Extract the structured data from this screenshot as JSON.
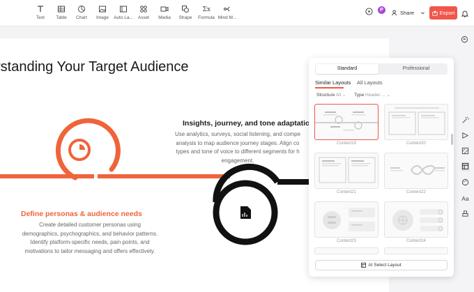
{
  "toolbar": {
    "tools": [
      {
        "label": "Text",
        "icon": "text-icon"
      },
      {
        "label": "Table",
        "icon": "table-icon"
      },
      {
        "label": "Chart",
        "icon": "chart-icon"
      },
      {
        "label": "Image",
        "icon": "image-icon"
      },
      {
        "label": "Auto La...",
        "icon": "auto-layout-icon"
      },
      {
        "label": "Asset",
        "icon": "asset-icon"
      },
      {
        "label": "Media",
        "icon": "media-icon"
      },
      {
        "label": "Shape",
        "icon": "shape-icon"
      },
      {
        "label": "Formula",
        "icon": "formula-icon"
      },
      {
        "label": "Mind M...",
        "icon": "mind-map-icon"
      }
    ],
    "avatar_letter": "P",
    "share_label": "Share",
    "export_label": "Export"
  },
  "slide": {
    "title": "rstanding Your Target Audience",
    "insight_title": "Insights, journey, and tone adaptation",
    "insight_lines": [
      "Use analytics, surveys, social listening, and compe",
      "analysis to map audience journey stages. Align co",
      "types and tone of voice to different segments for h",
      "engagement."
    ],
    "persona_title": "Define personas & audience needs",
    "persona_lines": [
      "Create detailed customer personas using",
      "demographics, psychographics, and behavior patterns.",
      "Identify platform-specific needs, pain points, and",
      "motivations to tailor messaging and offers effectively."
    ]
  },
  "panel": {
    "segments": [
      "Standard",
      "Professional"
    ],
    "tabs": [
      "Similar Layouts",
      "All Layouts"
    ],
    "filter_structure_label": "Structure",
    "filter_structure_value": "All",
    "filter_type_label": "Type",
    "filter_type_value": "Header ...",
    "cards": [
      "Content19",
      "Content20",
      "Content21",
      "Content22",
      "Content23",
      "Content24"
    ],
    "ai_button_label": "AI Select Layout"
  },
  "colors": {
    "accent": "#f0564a",
    "orange": "#f0643a",
    "dark": "#111111",
    "avatar": "#a648d8"
  }
}
